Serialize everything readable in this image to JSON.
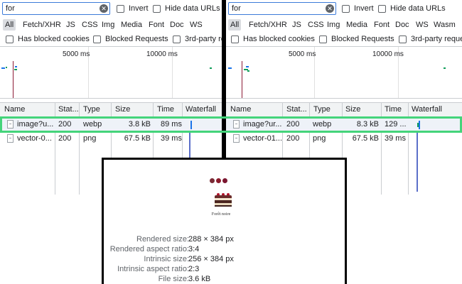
{
  "left_panel": {
    "filter": {
      "value": "for"
    },
    "toolbar": {
      "invert_label": "Invert",
      "hide_data_urls_label": "Hide data URLs"
    },
    "type_filters": [
      "All",
      "Fetch/XHR",
      "JS",
      "CSS",
      "Img",
      "Media",
      "Font",
      "Doc",
      "WS"
    ],
    "block_filters": [
      "Has blocked cookies",
      "Blocked Requests",
      "3rd-party re"
    ],
    "overview_ticks": [
      "5000 ms",
      "10000 ms"
    ],
    "columns": [
      "Name",
      "Stat...",
      "Type",
      "Size",
      "Time",
      "Waterfall"
    ],
    "rows": [
      {
        "name": "image?u...",
        "status": "200",
        "type": "webp",
        "size": "3.8 kB",
        "time": "89 ms"
      },
      {
        "name": "vector-0...",
        "status": "200",
        "type": "png",
        "size": "67.5 kB",
        "time": "39 ms"
      }
    ]
  },
  "right_panel": {
    "filter": {
      "value": "for"
    },
    "toolbar": {
      "invert_label": "Invert",
      "hide_data_urls_label": "Hide data URLs"
    },
    "type_filters": [
      "All",
      "Fetch/XHR",
      "JS",
      "CSS",
      "Img",
      "Media",
      "Font",
      "Doc",
      "WS",
      "Wasm"
    ],
    "block_filters": [
      "Has blocked cookies",
      "Blocked Requests",
      "3rd-party reque"
    ],
    "overview_ticks": [
      "5000 ms",
      "10000 ms"
    ],
    "columns": [
      "Name",
      "Stat...",
      "Type",
      "Size",
      "Time",
      "Waterfall"
    ],
    "rows": [
      {
        "name": "image?ur...",
        "status": "200",
        "type": "webp",
        "size": "8.3 kB",
        "time": "129 ..."
      },
      {
        "name": "vector-01...",
        "status": "200",
        "type": "png",
        "size": "67.5 kB",
        "time": "39 ms"
      }
    ]
  },
  "preview": {
    "thumbnail_caption": "Forêt noire",
    "info": [
      {
        "label": "Rendered size:",
        "value": "288 × 384 px"
      },
      {
        "label": "Rendered aspect ratio:",
        "value": "3:4"
      },
      {
        "label": "Intrinsic size:",
        "value": "256 × 384 px"
      },
      {
        "label": "Intrinsic aspect ratio:",
        "value": "2:3"
      },
      {
        "label": "File size:",
        "value": "3.6 kB"
      }
    ]
  },
  "colors": {
    "highlight": "#44d47a",
    "search_border": "#3c7bd9",
    "dom_content_loaded_line": "#8b1a35",
    "waterfall_bar": "#1a73e8"
  },
  "icons": [
    "clear-icon",
    "checkbox-icon",
    "file-icon"
  ]
}
